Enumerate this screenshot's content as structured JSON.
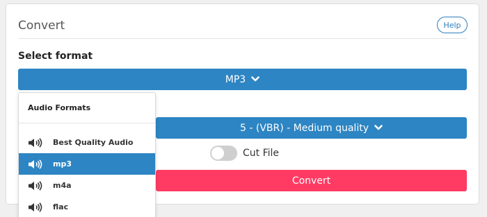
{
  "card": {
    "title": "Convert",
    "help_label": "Help"
  },
  "format": {
    "label": "Select format",
    "selected": "MP3",
    "quality": "5 - (VBR) - Medium quality"
  },
  "cut_file": {
    "label": "Cut File",
    "enabled": false
  },
  "convert_label": "Convert",
  "dropdown": {
    "header": "Audio Formats",
    "items": [
      {
        "label": "Best Quality Audio",
        "icon": "speaker-icon",
        "selected": false
      },
      {
        "label": "mp3",
        "icon": "speaker-icon",
        "selected": true
      },
      {
        "label": "m4a",
        "icon": "speaker-icon",
        "selected": false
      },
      {
        "label": "flac",
        "icon": "speaker-icon",
        "selected": false
      }
    ]
  },
  "colors": {
    "primary": "#2d85c3",
    "convert": "#ff3b64",
    "help": "#2d7dbd"
  }
}
